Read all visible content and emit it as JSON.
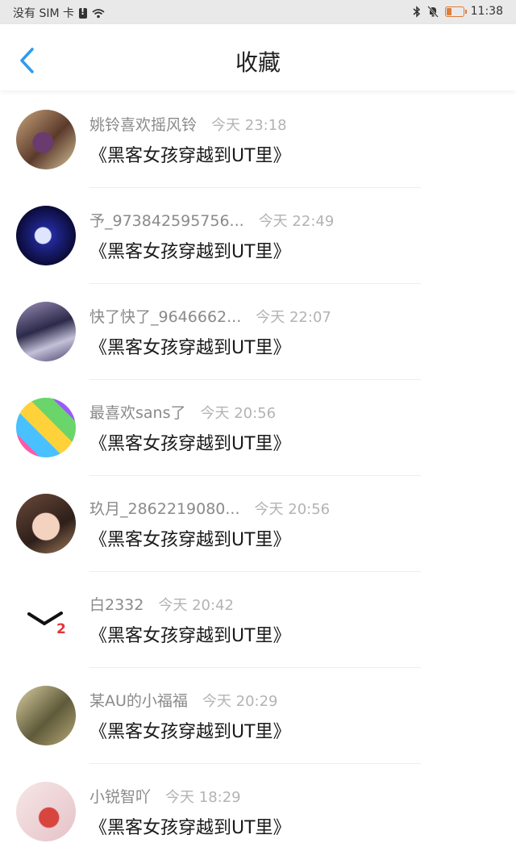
{
  "status_bar": {
    "carrier": "没有 SIM 卡",
    "time": "11:38",
    "icons": [
      "sim-warning-icon",
      "wifi-icon",
      "bluetooth-icon",
      "mute-bell-icon",
      "battery-icon"
    ],
    "battery_color": "#e07b3a"
  },
  "header": {
    "title": "收藏",
    "back_icon": "chevron-left-icon",
    "back_color": "#2d9cf0"
  },
  "items": [
    {
      "user": "姚铃喜欢摇风铃",
      "time": "今天 23:18",
      "book": "《黑客女孩穿越到UT里》"
    },
    {
      "user": "予_973842595756...",
      "time": "今天 22:49",
      "book": "《黑客女孩穿越到UT里》"
    },
    {
      "user": "快了快了_9646662...",
      "time": "今天 22:07",
      "book": "《黑客女孩穿越到UT里》"
    },
    {
      "user": "最喜欢sans了",
      "time": "今天 20:56",
      "book": "《黑客女孩穿越到UT里》"
    },
    {
      "user": "玖月_2862219080...",
      "time": "今天 20:56",
      "book": "《黑客女孩穿越到UT里》"
    },
    {
      "user": "白2332",
      "time": "今天 20:42",
      "book": "《黑客女孩穿越到UT里》"
    },
    {
      "user": "某AU的小福福",
      "time": "今天 20:29",
      "book": "《黑客女孩穿越到UT里》"
    },
    {
      "user": "小锐智吖",
      "time": "今天 18:29",
      "book": "《黑客女孩穿越到UT里》"
    }
  ]
}
